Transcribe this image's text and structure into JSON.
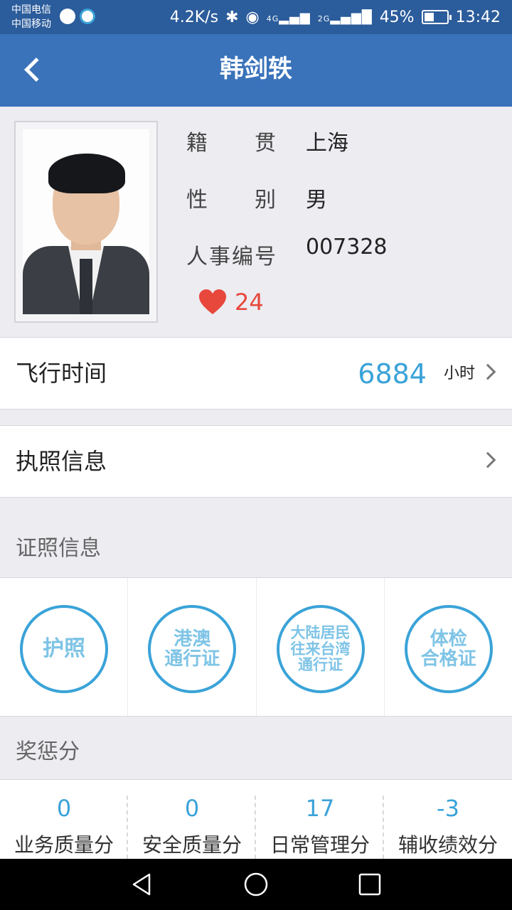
{
  "status_bar": {
    "carrier_1": "中国电信",
    "carrier_2": "中国移动",
    "net_speed": "4.2K/s",
    "net_type_1": "4G",
    "net_type_2": "2G",
    "battery": "45%",
    "battery_level": 0.45,
    "time": "13:42"
  },
  "nav": {
    "title": "韩剑轶",
    "back_icon": "chevron-left-icon"
  },
  "profile": {
    "native_place_label": "籍贯",
    "native_place": "上海",
    "gender_label": "性别",
    "gender": "男",
    "staff_id_label": "人事编号",
    "staff_id": "007328",
    "likes": "24",
    "like_icon": "heart-icon",
    "like_color": "#e8473c"
  },
  "flight_time": {
    "label": "飞行时间",
    "value": "6884",
    "unit": "小时"
  },
  "license": {
    "label": "执照信息"
  },
  "certificates": {
    "title": "证照信息",
    "items": [
      {
        "label": "护照"
      },
      {
        "label": "港澳\n通行证"
      },
      {
        "label": "大陆居民\n往来台湾\n通行证"
      },
      {
        "label": "体检\n合格证"
      }
    ]
  },
  "scores": {
    "title": "奖惩分",
    "items": [
      {
        "value": "0",
        "label": "业务质量分"
      },
      {
        "value": "0",
        "label": "安全质量分"
      },
      {
        "value": "17",
        "label": "日常管理分"
      },
      {
        "value": "-3",
        "label": "辅收绩效分"
      }
    ]
  },
  "colors": {
    "status_bar": "#2b5c9b",
    "nav_bar": "#3a73ba",
    "accent": "#3aa3d8",
    "background": "#ececf1"
  }
}
